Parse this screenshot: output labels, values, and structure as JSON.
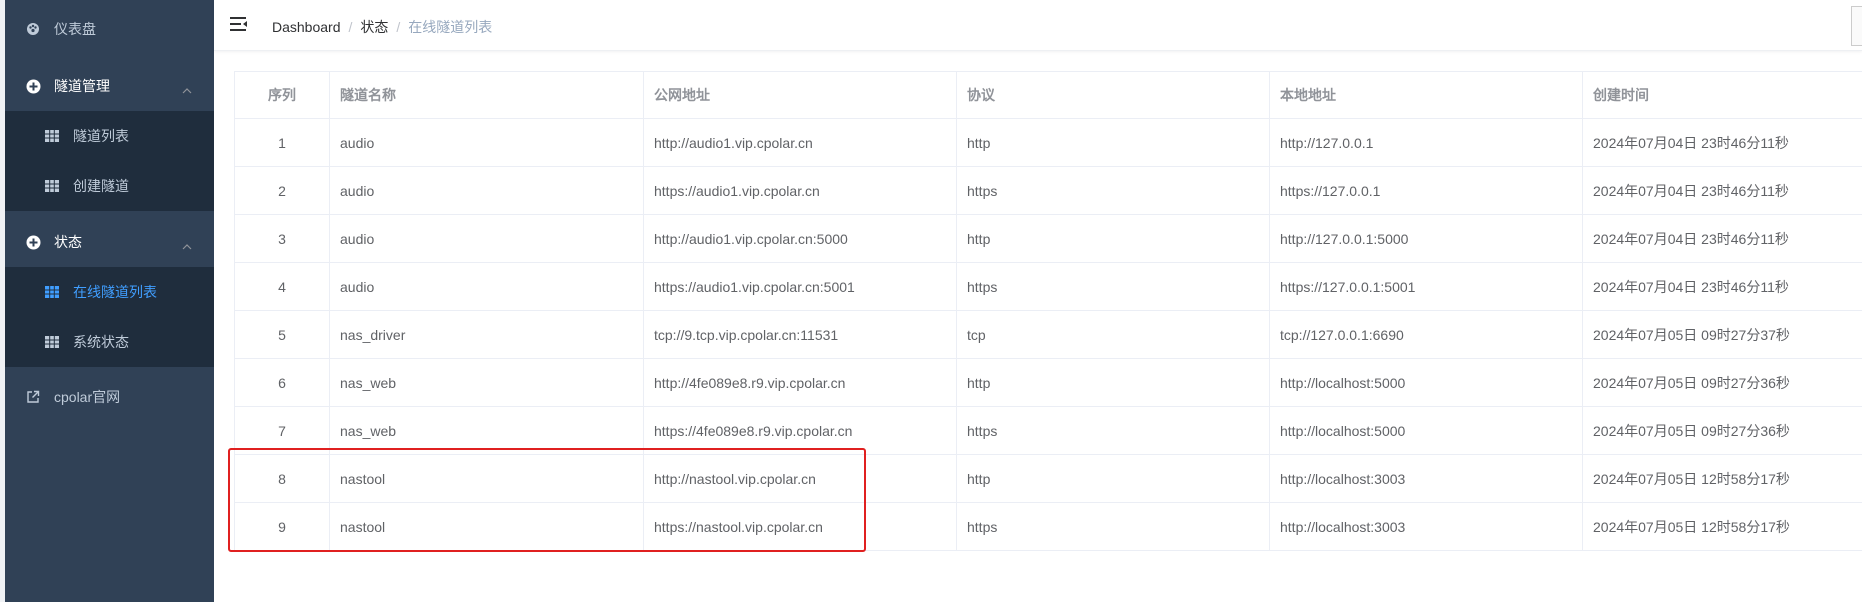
{
  "sidebar": {
    "dashboard": "仪表盘",
    "tunnel_mgmt": "隧道管理",
    "tunnel_list": "隧道列表",
    "create_tunnel": "创建隧道",
    "status": "状态",
    "online_tunnels": "在线隧道列表",
    "system_status": "系统状态",
    "official_site": "cpolar官网"
  },
  "breadcrumb": {
    "home": "Dashboard",
    "section": "状态",
    "current": "在线隧道列表"
  },
  "table": {
    "headers": [
      "序列",
      "隧道名称",
      "公网地址",
      "协议",
      "本地地址",
      "创建时间"
    ],
    "rows": [
      [
        "1",
        "audio",
        "http://audio1.vip.cpolar.cn",
        "http",
        "http://127.0.0.1",
        "2024年07月04日 23时46分11秒"
      ],
      [
        "2",
        "audio",
        "https://audio1.vip.cpolar.cn",
        "https",
        "https://127.0.0.1",
        "2024年07月04日 23时46分11秒"
      ],
      [
        "3",
        "audio",
        "http://audio1.vip.cpolar.cn:5000",
        "http",
        "http://127.0.0.1:5000",
        "2024年07月04日 23时46分11秒"
      ],
      [
        "4",
        "audio",
        "https://audio1.vip.cpolar.cn:5001",
        "https",
        "https://127.0.0.1:5001",
        "2024年07月04日 23时46分11秒"
      ],
      [
        "5",
        "nas_driver",
        "tcp://9.tcp.vip.cpolar.cn:11531",
        "tcp",
        "tcp://127.0.0.1:6690",
        "2024年07月05日 09时27分37秒"
      ],
      [
        "6",
        "nas_web",
        "http://4fe089e8.r9.vip.cpolar.cn",
        "http",
        "http://localhost:5000",
        "2024年07月05日 09时27分36秒"
      ],
      [
        "7",
        "nas_web",
        "https://4fe089e8.r9.vip.cpolar.cn",
        "https",
        "http://localhost:5000",
        "2024年07月05日 09时27分36秒"
      ],
      [
        "8",
        "nastool",
        "http://nastool.vip.cpolar.cn",
        "http",
        "http://localhost:3003",
        "2024年07月05日 12时58分17秒"
      ],
      [
        "9",
        "nastool",
        "https://nastool.vip.cpolar.cn",
        "https",
        "http://localhost:3003",
        "2024年07月05日 12时58分17秒"
      ]
    ]
  },
  "colors": {
    "sidebar_bg": "#304156",
    "submenu_bg": "#1f2d3d",
    "active": "#409eff",
    "highlight": "#e02020"
  }
}
